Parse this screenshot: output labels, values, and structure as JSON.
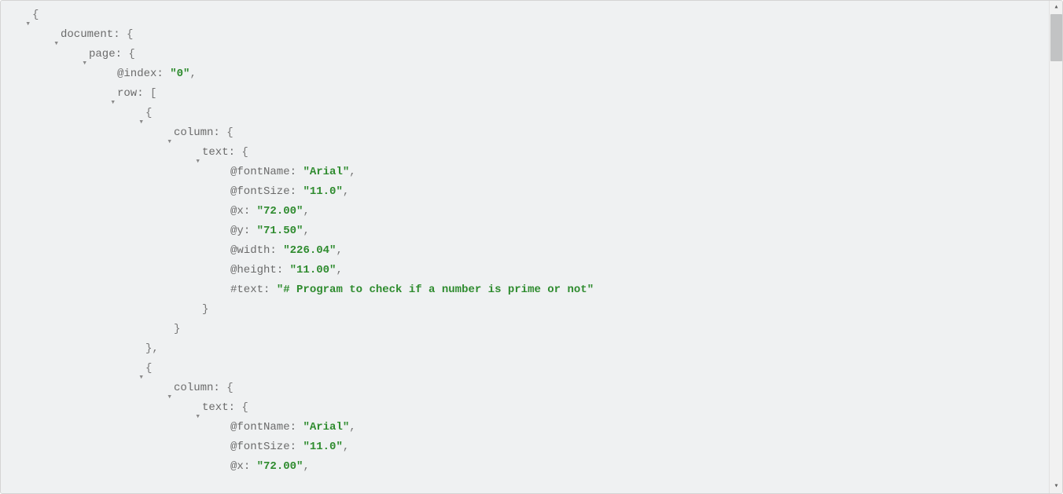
{
  "tree": {
    "root_brace_open": "{",
    "document_key": "document",
    "document_brace": "{",
    "page_key": "page",
    "page_brace": "{",
    "index_key": "@index",
    "index_val": "\"0\"",
    "row_key": "row",
    "row_bracket": "[",
    "item1_brace": "{",
    "column_key": "column",
    "column_brace": "{",
    "text_key": "text",
    "text_brace": "{",
    "fontName_key": "@fontName",
    "fontName_val": "\"Arial\"",
    "fontSize_key": "@fontSize",
    "fontSize_val": "\"11.0\"",
    "x_key": "@x",
    "x_val": "\"72.00\"",
    "y_key": "@y",
    "y_val": "\"71.50\"",
    "width_key": "@width",
    "width_val": "\"226.04\"",
    "height_key": "@height",
    "height_val": "\"11.00\"",
    "textcontent_key": "#text",
    "textcontent_val": "\"# Program to check if a number is prime or not\"",
    "close_brace": "}",
    "close_brace_comma": "},",
    "item2_brace": "{",
    "column2_key": "column",
    "column2_brace": "{",
    "text2_key": "text",
    "text2_brace": "{",
    "fontName2_key": "@fontName",
    "fontName2_val": "\"Arial\"",
    "fontSize2_key": "@fontSize",
    "fontSize2_val": "\"11.0\"",
    "x2_key": "@x",
    "x2_val": "\"72.00\""
  }
}
